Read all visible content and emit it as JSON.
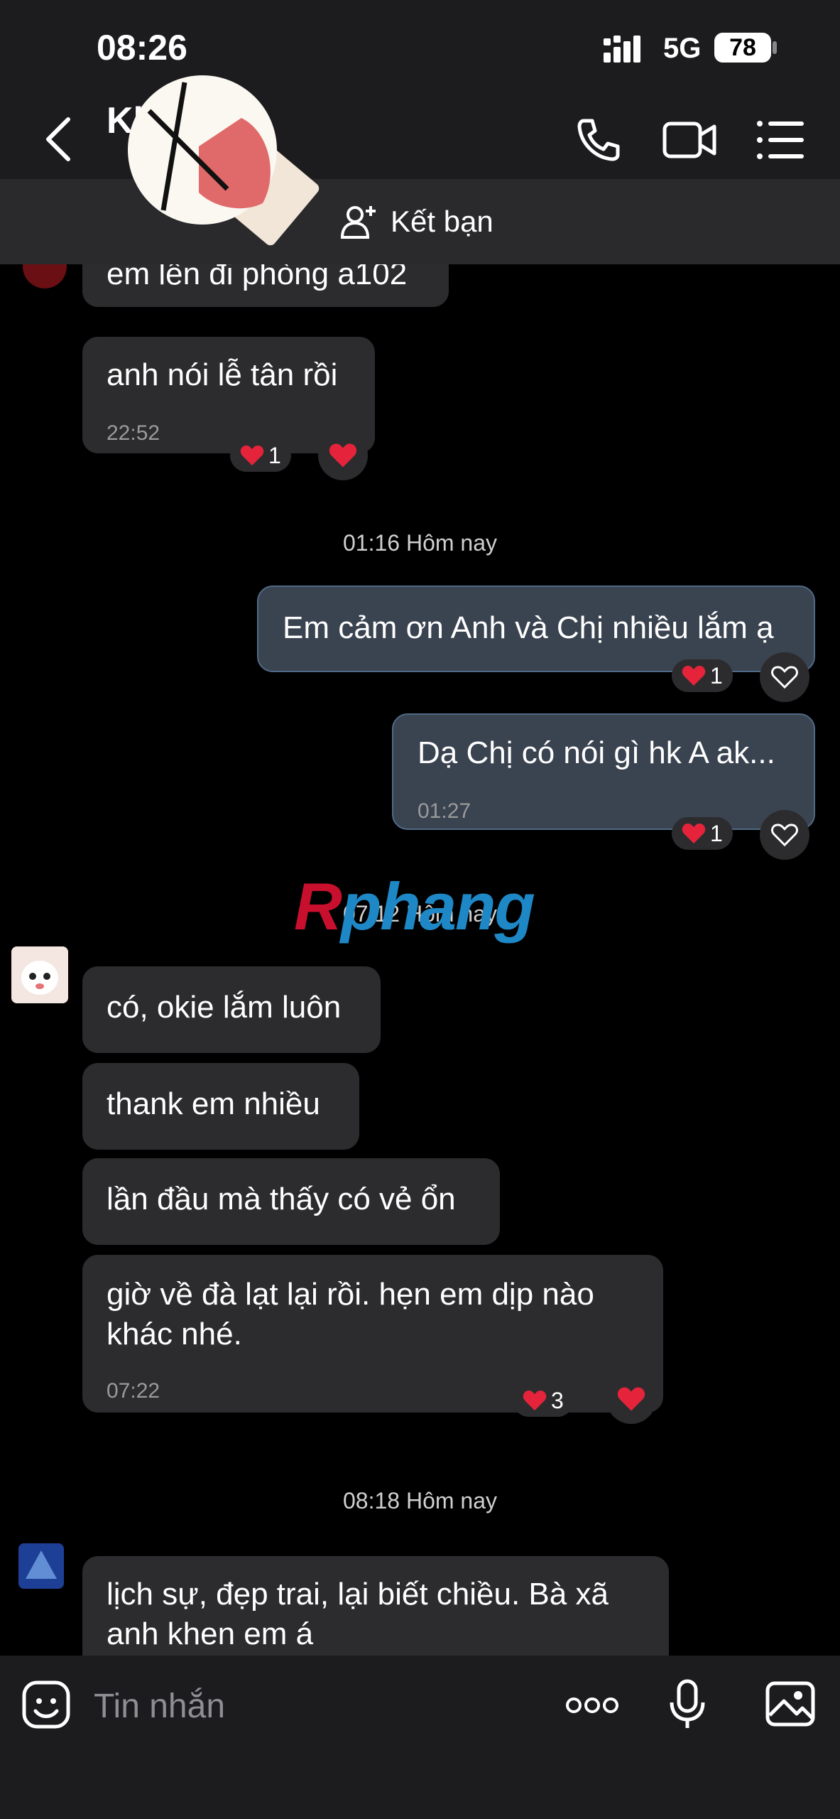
{
  "status_bar": {
    "time": "08:26",
    "network": "5G",
    "battery": "78"
  },
  "header": {
    "contact_name": "Kh      i"
  },
  "friend_bar": {
    "add_friend_label": "Kết bạn"
  },
  "messages": {
    "m1": {
      "text": "em lên đi phòng a102"
    },
    "m2": {
      "text": "anh nói lễ tân rồi",
      "time": "22:52",
      "reaction_count": "1"
    },
    "sep1": "01:16 Hôm nay",
    "m3": {
      "text": "Em cảm ơn Anh và Chị nhiều lắm ạ",
      "reaction_count": "1"
    },
    "m4": {
      "text": "Dạ Chị có nói gì hk A ak...",
      "time": "01:27",
      "reaction_count": "1"
    },
    "sep2": "07:12 Hôm nay",
    "m5": {
      "text": "có, okie lắm luôn"
    },
    "m6": {
      "text": "thank em nhiều"
    },
    "m7": {
      "text": "lần đầu mà thấy có vẻ ổn"
    },
    "m8": {
      "line1": "giờ  về đà lạt lại rồi. hẹn em dịp nào",
      "line2": "khác nhé.",
      "time": "07:22",
      "reaction_count": "3"
    },
    "sep3": "08:18 Hôm nay",
    "m9": {
      "line1": "lịch sự, đẹp trai, lại biết chiều. Bà xã",
      "line2": "anh khen em á"
    }
  },
  "watermark": {
    "first": "R",
    "rest": "phang"
  },
  "input": {
    "placeholder": "Tin nhắn"
  },
  "colors": {
    "heart": "#e5243b",
    "outgoing_bubble": "#3a4350",
    "incoming_bubble": "#2c2c2e"
  }
}
